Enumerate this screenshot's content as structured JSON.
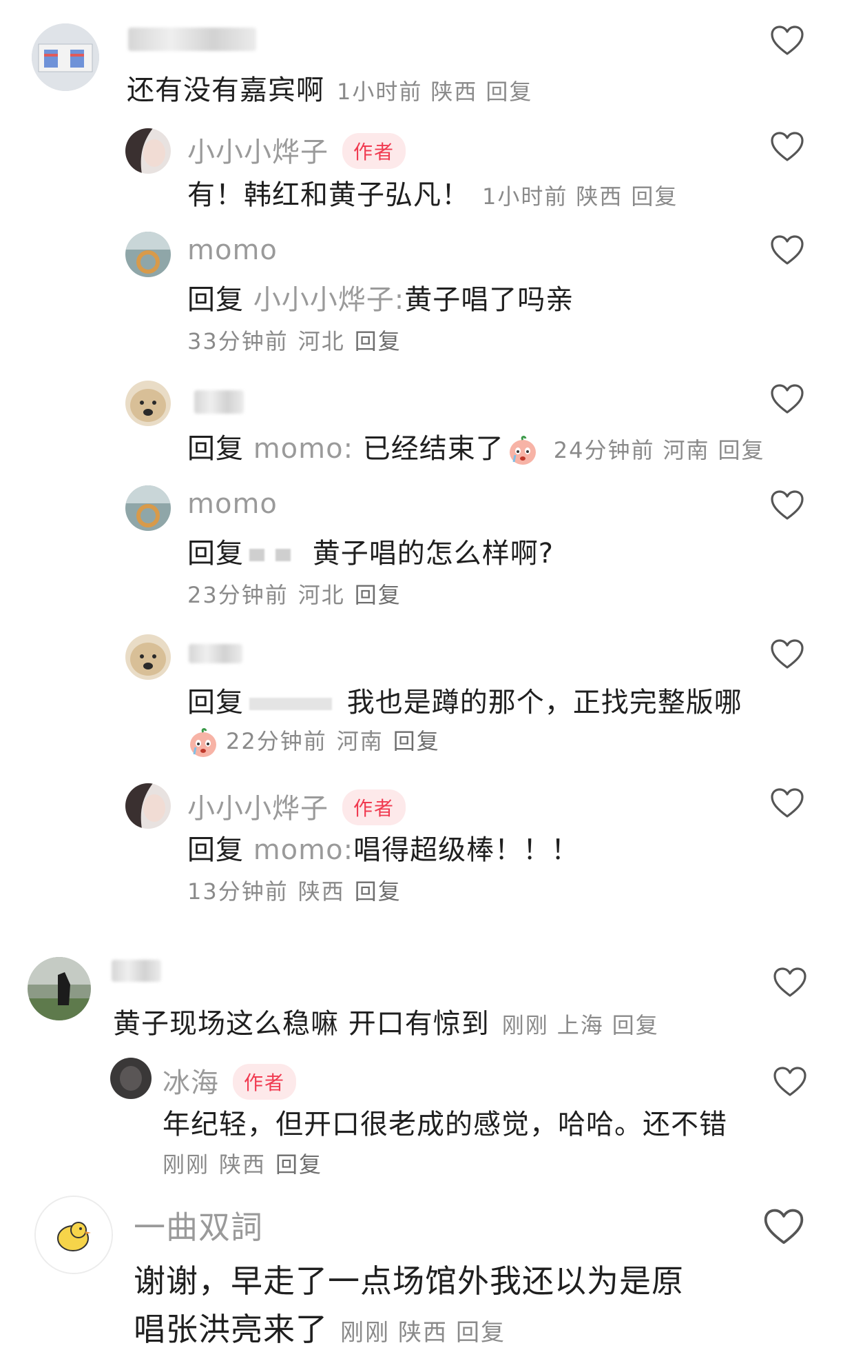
{
  "comments": [
    {
      "name": "",
      "text": "还有没有嘉宾啊",
      "time": "1小时前",
      "location": "陕西",
      "reply": "回复"
    },
    {
      "name": "小小小烨子",
      "badge": "作者",
      "text": "有！韩红和黄子弘凡！",
      "time": "1小时前",
      "location": "陕西",
      "reply": "回复"
    },
    {
      "name": "momo",
      "reply_prefix": "回复",
      "reply_target": "小小小烨子:",
      "text": "黄子唱了吗亲",
      "time": "33分钟前",
      "location": "河北",
      "reply": "回复"
    },
    {
      "name": "",
      "reply_prefix": "回复",
      "reply_target": "momo:",
      "text": "已经结束了",
      "time": "24分钟前",
      "location": "河南",
      "reply": "回复"
    },
    {
      "name": "momo",
      "reply_prefix": "回复",
      "text": "黄子唱的怎么样啊?",
      "time": "23分钟前",
      "location": "河北",
      "reply": "回复"
    },
    {
      "name": "",
      "reply_prefix": "回复",
      "text": "我也是蹲的那个，正找完整版哪",
      "time": "22分钟前",
      "location": "河南",
      "reply": "回复"
    },
    {
      "name": "小小小烨子",
      "badge": "作者",
      "reply_prefix": "回复",
      "reply_target": "momo:",
      "text": "唱得超级棒！！！",
      "time": "13分钟前",
      "location": "陕西",
      "reply": "回复"
    },
    {
      "name": "",
      "text": "黄子现场这么稳嘛 开口有惊到",
      "time": "刚刚",
      "location": "上海",
      "reply": "回复"
    },
    {
      "name": "冰海",
      "badge": "作者",
      "text": "年纪轻，但开口很老成的感觉，哈哈。还不错",
      "time": "刚刚",
      "location": "陕西",
      "reply": "回复"
    },
    {
      "name": "一曲双詞",
      "text_line1": "谢谢，早走了一点场馆外我还以为是原",
      "text_line2": "唱张洪亮来了",
      "time": "刚刚",
      "location": "陕西",
      "reply": "回复"
    }
  ],
  "icons": {
    "like": "heart-outline-icon",
    "emoji": "peach-crying-emoji"
  },
  "colors": {
    "badge_bg": "#fde9ea",
    "badge_text": "#f03a50",
    "secondary_text": "#9a9a9a"
  }
}
